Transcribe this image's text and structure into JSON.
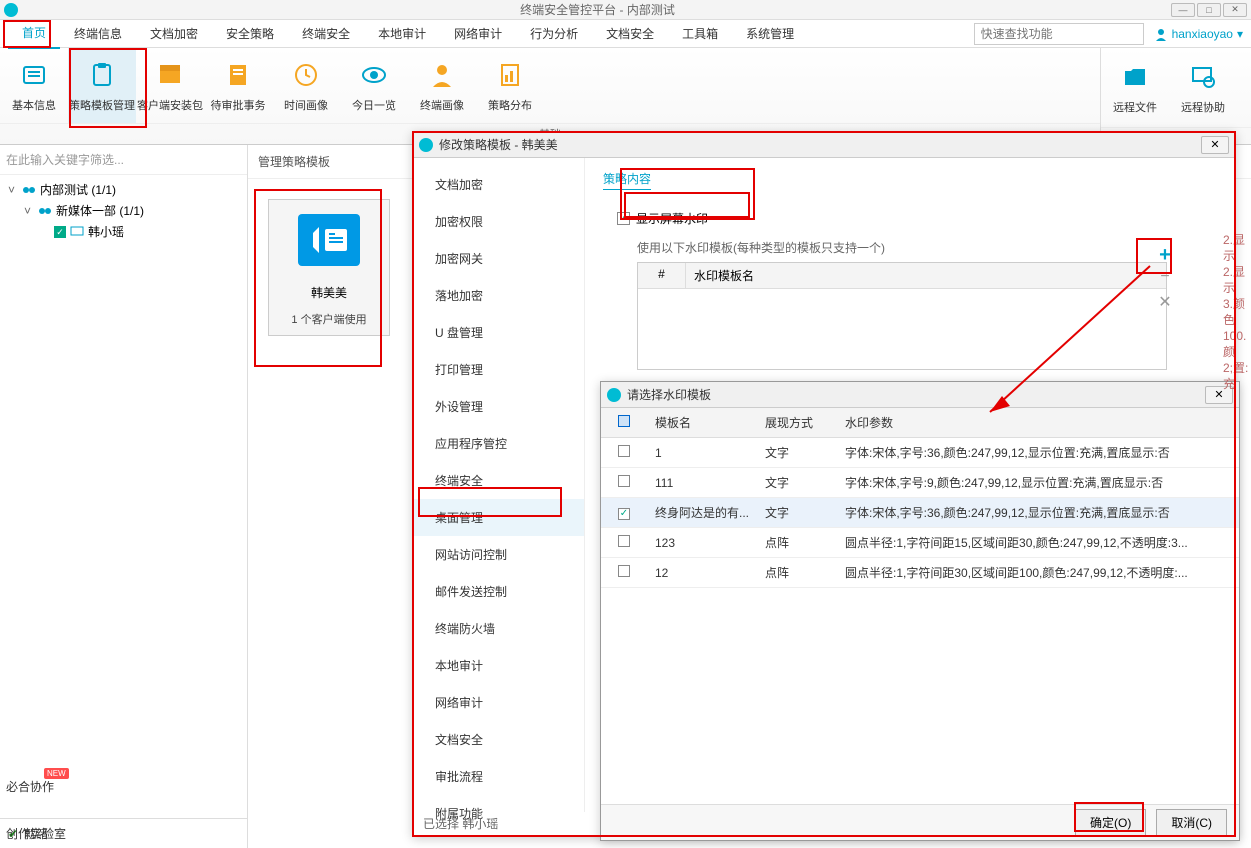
{
  "window": {
    "title": "终端安全管控平台 - 内部测试"
  },
  "search_placeholder": "快速查找功能",
  "user": "hanxiaoyao",
  "tabs": [
    "首页",
    "终端信息",
    "文档加密",
    "安全策略",
    "终端安全",
    "本地审计",
    "网络审计",
    "行为分析",
    "文档安全",
    "工具箱",
    "系统管理"
  ],
  "ribbon": {
    "group1": {
      "caption": "基础",
      "items": [
        "基本信息",
        "策略模板管理",
        "客户端安装包",
        "待审批事务",
        "时间画像",
        "今日一览",
        "终端画像",
        "策略分布"
      ]
    },
    "group2": {
      "items": [
        "远程文件",
        "远程协助"
      ]
    }
  },
  "filter_placeholder": "在此输入关键字筛选...",
  "tree": {
    "n0": "内部测试 (1/1)",
    "n1": "新媒体一部 (1/1)",
    "n2": "韩小瑶"
  },
  "status_text": "就绪",
  "mid_header": "管理策略模板",
  "template": {
    "name": "韩美美",
    "sub": "1 个客户端使用"
  },
  "dlg1": {
    "title": "修改策略模板 - 韩美美",
    "nav": [
      "文档加密",
      "加密权限",
      "加密网关",
      "落地加密",
      "U 盘管理",
      "打印管理",
      "外设管理",
      "应用程序管控",
      "终端安全",
      "桌面管理",
      "网站访问控制",
      "邮件发送控制",
      "终端防火墙",
      "本地审计",
      "网络审计",
      "文档安全",
      "审批流程",
      "附属功能"
    ],
    "section": "策略内容",
    "checkbox_label": "显示屏幕水印",
    "hint": "使用以下水印模板(每种类型的模板只支持一个)",
    "col_hash": "#",
    "col_name": "水印模板名",
    "footer": "已选择 韩小瑶"
  },
  "dlg2": {
    "title": "请选择水印模板",
    "cols": [
      "",
      "模板名",
      "展现方式",
      "水印参数"
    ],
    "rows": [
      {
        "c": false,
        "name": "1",
        "mode": "文字",
        "param": "字体:宋体,字号:36,颜色:247,99,12,显示位置:充满,置底显示:否"
      },
      {
        "c": false,
        "name": "111",
        "mode": "文字",
        "param": "字体:宋体,字号:9,颜色:247,99,12,显示位置:充满,置底显示:否"
      },
      {
        "c": true,
        "name": "终身阿达是的有...",
        "mode": "文字",
        "param": "字体:宋体,字号:36,颜色:247,99,12,显示位置:充满,置底显示:否"
      },
      {
        "c": false,
        "name": "123",
        "mode": "点阵",
        "param": "圆点半径:1,字符间距15,区域间距30,颜色:247,99,12,不透明度:3..."
      },
      {
        "c": false,
        "name": "12",
        "mode": "点阵",
        "param": "圆点半径:1,字符间距30,区域间距100,颜色:247,99,12,不透明度:..."
      }
    ],
    "ok": "确定(O)",
    "cancel": "取消(C)"
  },
  "peek": [
    "2.显示",
    "2.显示",
    "3.颜色",
    "100.颜",
    "2;置:充"
  ],
  "bottom": {
    "label": "必合协作",
    "badge": "NEW",
    "label2": "创作实验室"
  },
  "colors": {
    "accent": "#00a2ca",
    "red": "#e30000"
  }
}
